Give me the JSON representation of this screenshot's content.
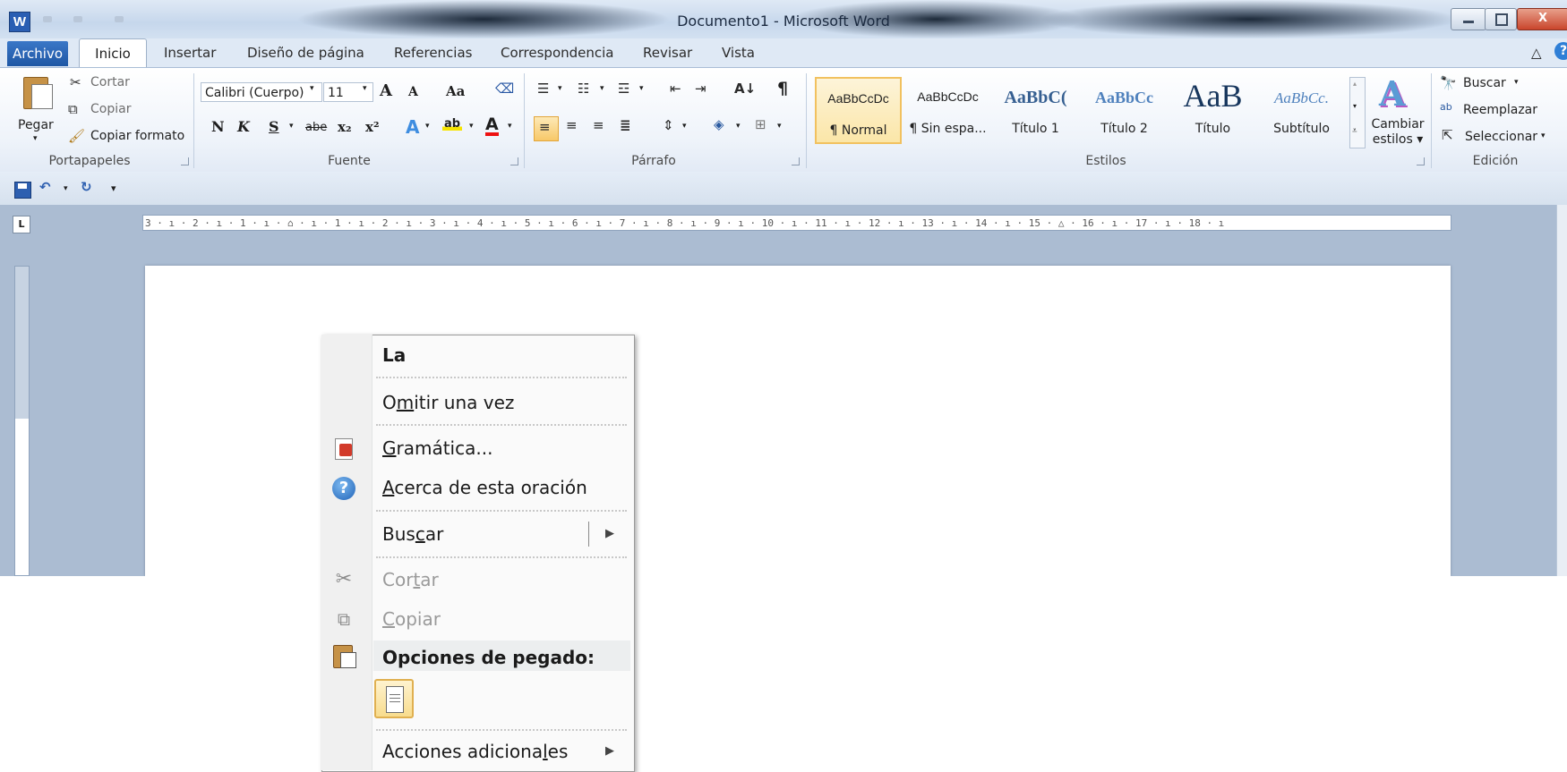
{
  "window": {
    "title": "Documento1  -  Microsoft Word",
    "app_icon": "W",
    "close": "X"
  },
  "tabs": [
    "Archivo",
    "Inicio",
    "Insertar",
    "Diseño de página",
    "Referencias",
    "Correspondencia",
    "Revisar",
    "Vista"
  ],
  "active_tab": "Inicio",
  "clipboard": {
    "paste": "Pegar",
    "cut": "Cortar",
    "copy": "Copiar",
    "format_painter": "Copiar formato",
    "group": "Portapapeles"
  },
  "font": {
    "name": "Calibri (Cuerpo)",
    "size": "11",
    "group": "Fuente",
    "bold": "N",
    "italic": "K",
    "underline": "S",
    "strike": "abe",
    "subscript": "x₂",
    "superscript": "x²",
    "grow": "A",
    "shrink": "A",
    "change_case": "Aa",
    "highlight": "ab",
    "color": "A"
  },
  "paragraph": {
    "group": "Párrafo",
    "show_marks": "¶",
    "sort": "A↓"
  },
  "styles": {
    "group": "Estilos",
    "items": [
      {
        "sample": "AaBbCcDc",
        "name": "¶ Normal"
      },
      {
        "sample": "AaBbCcDc",
        "name": "¶ Sin espa..."
      },
      {
        "sample": "AaBbC(",
        "name": "Título 1"
      },
      {
        "sample": "AaBbCc",
        "name": "Título 2"
      },
      {
        "sample": "AaB",
        "name": "Título"
      },
      {
        "sample": "AaBbCc.",
        "name": "Subtítulo"
      }
    ],
    "change_styles": "Cambiar estilos",
    "change_styles_line1": "Cambiar",
    "change_styles_line2": "estilos ▾"
  },
  "editing": {
    "group": "Edición",
    "find": "Buscar",
    "replace": "Reemplazar",
    "select": "Seleccionar"
  },
  "ruler_text": "3 · ı · 2 · ı · 1 · ı · ⌂ · ı · 1 · ı · 2 · ı · 3 · ı · 4 · ı · 5 · ı · 6 · ı · 7 · ı · 8 · ı · 9 · ı · 10 · ı · 11 · ı · 12 · ı · 13 · ı · 14 · ı · 15 · △ · 16 · ı · 17 · ı · 18 · ı",
  "ruler_corner": "L",
  "context_menu": {
    "suggestion": "La",
    "ignore": {
      "pre": "O",
      "ul": "m",
      "post": "itir una vez"
    },
    "grammar": {
      "pre": "",
      "ul": "G",
      "post": "ramática..."
    },
    "about": {
      "pre": "",
      "ul": "A",
      "post": "cerca de esta oración"
    },
    "search": {
      "pre": "Bus",
      "ul": "c",
      "post": "ar"
    },
    "cut": {
      "pre": "Cor",
      "ul": "t",
      "post": "ar"
    },
    "copy": {
      "pre": "",
      "ul": "C",
      "post": "opiar"
    },
    "paste_options": "Opciones de pegado:",
    "more_actions": {
      "pre": "Acciones adiciona",
      "ul": "l",
      "post": "es"
    }
  }
}
